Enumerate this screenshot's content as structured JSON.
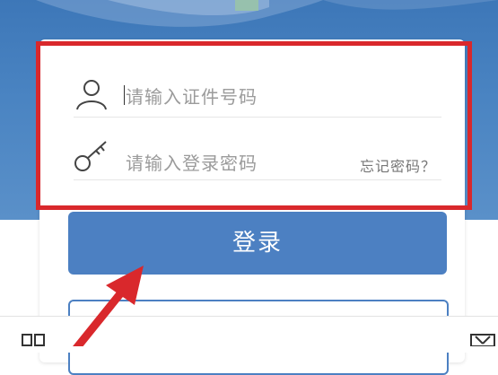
{
  "login_form": {
    "id_placeholder": "请输入证件号码",
    "password_placeholder": "请输入登录密码",
    "forgot_password": "忘记密码？",
    "login_button": "登录"
  },
  "icons": {
    "user": "user-icon",
    "key": "key-icon",
    "grid": "grid-icon",
    "close": "close-box-icon"
  },
  "colors": {
    "banner": "#4a84c2",
    "primary": "#4c80c2",
    "highlight": "#d9282c"
  }
}
